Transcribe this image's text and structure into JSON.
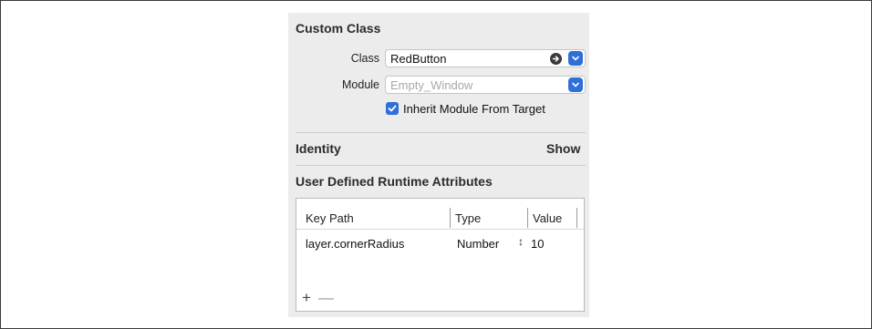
{
  "custom_class": {
    "title": "Custom Class",
    "class_label": "Class",
    "class_value": "RedButton",
    "module_label": "Module",
    "module_placeholder": "Empty_Window",
    "inherit_label": "Inherit Module From Target",
    "inherit_checked": true
  },
  "identity": {
    "title": "Identity",
    "action": "Show"
  },
  "runtime_attributes": {
    "title": "User Defined Runtime Attributes",
    "columns": [
      "Key Path",
      "Type",
      "Value"
    ],
    "rows": [
      {
        "key_path": "layer.cornerRadius",
        "type": "Number",
        "value": "10"
      }
    ],
    "add_symbol": "+",
    "remove_symbol": "—"
  },
  "colors": {
    "accent": "#2f6fd8",
    "panel_bg": "#ececec"
  },
  "icons": {
    "class_navigate": "arrow-circle-right-icon",
    "class_dropdown": "chevron-down-icon",
    "module_dropdown": "chevron-down-icon",
    "checkbox": "checkmark-icon",
    "type_stepper": "up-down-stepper-icon"
  }
}
